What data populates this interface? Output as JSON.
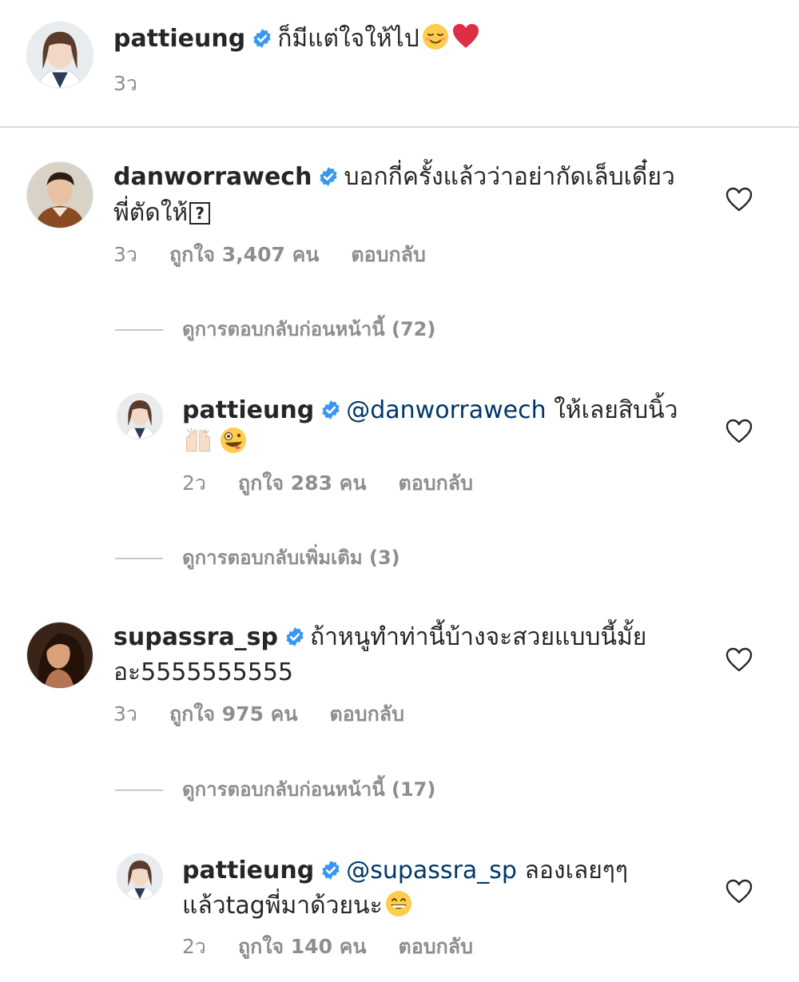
{
  "caption": {
    "username": "pattieung",
    "text": "ก็มีแต่ใจให้ไป",
    "time": "3ว"
  },
  "comments": [
    {
      "username": "danworrawech",
      "line1": "บอกกี่ครั้งแล้วว่าอย่ากัดเล็บเดี๋ยว",
      "line2": "พี่ตัดให้",
      "time": "3ว",
      "likes": "ถูกใจ 3,407 คน",
      "reply": "ตอบกลับ",
      "view_replies": "ดูการตอบกลับก่อนหน้านี้ (72)",
      "reply_item": {
        "username": "pattieung",
        "mention": "@danworrawech",
        "line1_rest": "ให้เลยสิบนิ้ว",
        "time": "2ว",
        "likes": "ถูกใจ 283 คน",
        "reply": "ตอบกลับ"
      },
      "more_replies": "ดูการตอบกลับเพิ่มเติม (3)"
    },
    {
      "username": "supassra_sp",
      "line1": "ถ้าหนูทำท่านี้บ้างจะสวยแบบนี้มั้ย",
      "line2": "อะ5555555555",
      "time": "3ว",
      "likes": "ถูกใจ 975 คน",
      "reply": "ตอบกลับ",
      "view_replies": "ดูการตอบกลับก่อนหน้านี้ (17)",
      "reply_item": {
        "username": "pattieung",
        "mention": "@supassra_sp",
        "line1_rest": "ลองเลยๆๆ",
        "line2": "แล้วtagพี่มาด้วยนะ",
        "time": "2ว",
        "likes": "ถูกใจ 140 คน",
        "reply": "ตอบกลับ"
      }
    }
  ],
  "icons": {
    "verified": "verified-badge-icon",
    "heart": "heart-outline-icon"
  },
  "colors": {
    "verified_blue": "#3897f0",
    "mention": "#00376b",
    "meta_gray": "#8e8e8e"
  }
}
